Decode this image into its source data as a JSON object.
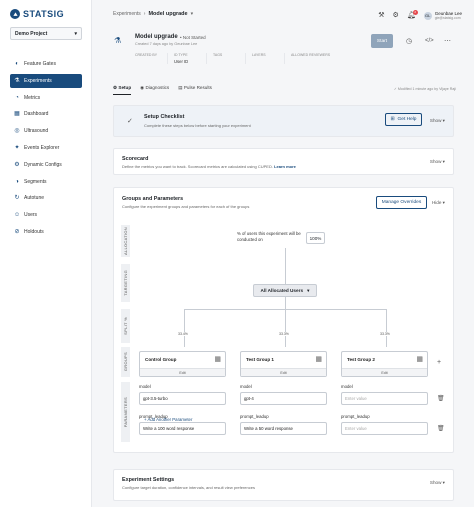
{
  "sidebar": {
    "logo_text": "STATSIG",
    "project": "Demo Project",
    "items": [
      {
        "label": "Feature Gates",
        "icon": "toggle-icon"
      },
      {
        "label": "Experiments",
        "icon": "flask-icon",
        "active": true
      },
      {
        "label": "Metrics",
        "icon": "chart-icon"
      },
      {
        "label": "Dashboard",
        "icon": "dashboard-icon"
      },
      {
        "label": "Ultrasound",
        "icon": "ultrasound-icon"
      },
      {
        "label": "Events Explorer",
        "icon": "events-icon"
      },
      {
        "label": "Dynamic Configs",
        "icon": "config-icon"
      },
      {
        "label": "Segments",
        "icon": "segments-icon"
      },
      {
        "label": "Autotune",
        "icon": "autotune-icon"
      },
      {
        "label": "Users",
        "icon": "users-icon"
      },
      {
        "label": "Holdouts",
        "icon": "holdouts-icon"
      }
    ]
  },
  "topbar": {
    "breadcrumb_parent": "Experiments",
    "breadcrumb_sep": "›",
    "breadcrumb_current": "Model upgrade",
    "notification_count": "2",
    "user_name": "Geunbae Lee",
    "user_email": "gle@statsig.com",
    "avatar_initials": "GL"
  },
  "experiment": {
    "title": "Model upgrade",
    "status": "• Not Started",
    "created": "Created 7 days ago by Geunbae Lee",
    "meta": [
      {
        "label": "CREATED BY",
        "value": ""
      },
      {
        "label": "ID TYPE",
        "value": "User ID"
      },
      {
        "label": "TAGS",
        "value": ""
      },
      {
        "label": "LAYERS",
        "value": ""
      },
      {
        "label": "ALLOWED REVIEWERS",
        "value": ""
      }
    ],
    "start_label": "Start",
    "modified": "Modified 1 minute ago by Vijaye Raji"
  },
  "tabs": [
    "Setup",
    "Diagnostics",
    "Pulse Results"
  ],
  "checklist": {
    "title": "Setup Checklist",
    "desc": "Complete these steps below before starting your experiment",
    "help_label": "Get Help",
    "show_label": "Show"
  },
  "scorecard": {
    "title": "Scorecard",
    "desc": "Define the metrics you want to track. Scorecard metrics are calculated using CUPED.",
    "link": "Learn more",
    "show_label": "Show"
  },
  "groups_params": {
    "title": "Groups and Parameters",
    "desc": "Configure the experiment groups and parameters for each of the groups",
    "manage_label": "Manage Overrides",
    "hide_label": "Hide",
    "labels": {
      "allocation": "ALLOCATION",
      "targeting": "TARGETING",
      "split": "SPLIT %",
      "groups": "GROUPS",
      "parameters": "PARAMETERS"
    },
    "alloc_text": "% of users this experiment will be conducted on",
    "alloc_value": "100%",
    "targeting_value": "All Allocated Users",
    "groups": [
      {
        "name": "Control Group",
        "pct": "33.4%",
        "edit": "Edit",
        "params": [
          {
            "label": "model",
            "value": "gpt-3.5-turbo"
          },
          {
            "label": "prompt_leadup",
            "value": "Write a 100 word response"
          }
        ]
      },
      {
        "name": "Test Group 1",
        "pct": "33.3%",
        "edit": "Edit",
        "params": [
          {
            "label": "model",
            "value": "gpt-4"
          },
          {
            "label": "prompt_leadup",
            "value": "Write a 50 word response"
          }
        ]
      },
      {
        "name": "Test Group 2",
        "pct": "33.3%",
        "edit": "Edit",
        "params": [
          {
            "label": "model",
            "value": "Enter value"
          },
          {
            "label": "prompt_leadup",
            "value": "Enter value"
          }
        ]
      }
    ],
    "add_param": "+ Add Another Parameter"
  },
  "settings": {
    "title": "Experiment Settings",
    "desc": "Configure target duration, confidence intervals, and result view preferences",
    "show_label": "Show"
  }
}
